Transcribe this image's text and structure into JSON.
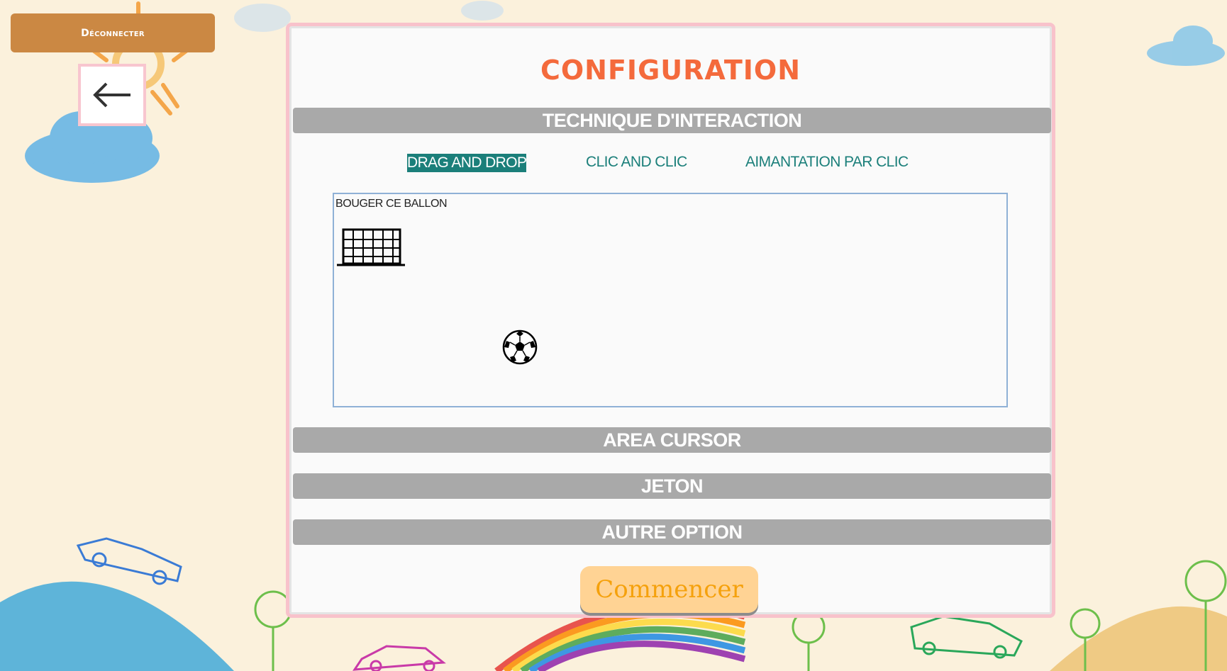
{
  "colors": {
    "background": "#fbf1dc",
    "disconnect_button": "#cb8843",
    "panel_border": "#f8c2cb",
    "title": "#f46a3c",
    "section_bar": "#a9a9a9",
    "technique_text": "#1b7f7a",
    "start_button": "#ffd394",
    "start_text": "#f5a10c"
  },
  "header": {
    "disconnect_label": "Déconnecter",
    "back_icon": "arrow-left-icon"
  },
  "config": {
    "title": "CONFIGURATION",
    "sections": {
      "interaction": "TECHNIQUE D'INTERACTION",
      "area_cursor": "AREA CURSOR",
      "jeton": "JETON",
      "autre": "AUTRE OPTION"
    },
    "techniques": [
      {
        "label": "DRAG AND DROP",
        "selected": true
      },
      {
        "label": "CLIC AND CLIC",
        "selected": false
      },
      {
        "label": "AIMANTATION PAR CLIC",
        "selected": false
      }
    ],
    "demo": {
      "label": "BOUGER CE BALLON",
      "goal_icon": "soccer-goal-icon",
      "ball_icon": "soccer-ball-icon"
    },
    "start_label": "Commencer"
  }
}
